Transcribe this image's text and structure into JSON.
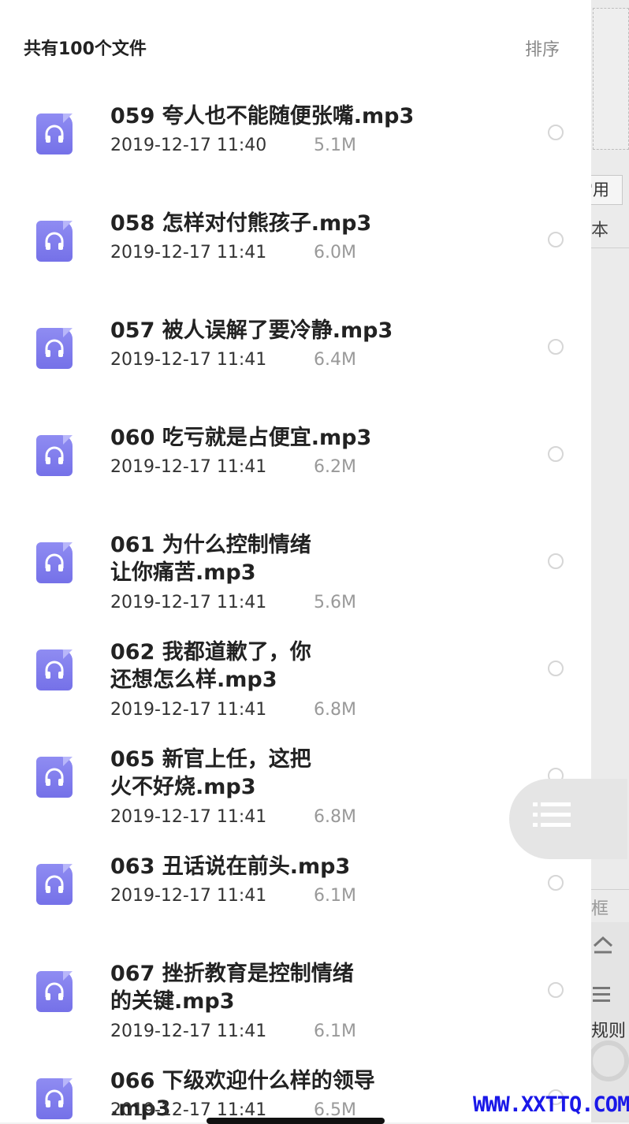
{
  "header": {
    "file_count": "共有100个文件",
    "sort_label": "排序"
  },
  "background_app": {
    "tab_label": "常用",
    "row_text": "本",
    "frame_text": "框",
    "rule_text": "规则"
  },
  "files": [
    {
      "name": "059 夸人也不能随便张嘴.mp3",
      "date": "2019-12-17 11:40",
      "size": "5.1M"
    },
    {
      "name": "058 怎样对付熊孩子.mp3",
      "date": "2019-12-17 11:41",
      "size": "6.0M"
    },
    {
      "name": "057 被人误解了要冷静.mp3",
      "date": "2019-12-17 11:41",
      "size": "6.4M"
    },
    {
      "name": "060 吃亏就是占便宜.mp3",
      "date": "2019-12-17 11:41",
      "size": "6.2M"
    },
    {
      "name": "061 为什么控制情绪让你痛苦.mp3",
      "date": "2019-12-17 11:41",
      "size": "5.6M"
    },
    {
      "name": "062 我都道歉了，你还想怎么样.mp3",
      "date": "2019-12-17 11:41",
      "size": "6.8M"
    },
    {
      "name": "065 新官上任，这把火不好烧.mp3",
      "date": "2019-12-17 11:41",
      "size": "6.8M"
    },
    {
      "name": "063 丑话说在前头.mp3",
      "date": "2019-12-17 11:41",
      "size": "6.1M"
    },
    {
      "name": "067 挫折教育是控制情绪的关键.mp3",
      "date": "2019-12-17 11:41",
      "size": "6.1M"
    },
    {
      "name": "066 下级欢迎什么样的领导 .mp3",
      "date": "2019-12-17 11:41",
      "size": "6.5M"
    }
  ],
  "watermark": "WWW.XXTTQ.COM",
  "colors": {
    "icon_accent": "#7f7bee",
    "watermark": "#1a18e8"
  },
  "icons": {
    "file_icon": "headphones-icon",
    "float_button": "list-icon"
  }
}
